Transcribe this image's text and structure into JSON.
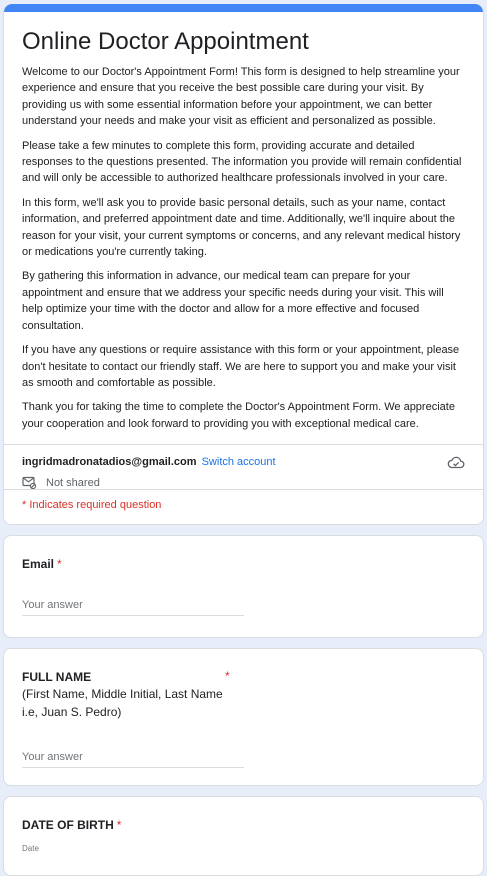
{
  "form": {
    "title": "Online Doctor Appointment",
    "description": [
      "Welcome to our Doctor's Appointment Form! This form is designed to help streamline your experience and ensure that you receive the best possible care during your visit. By providing us with some essential information before your appointment, we can better understand your needs and make your visit as efficient and personalized as possible.",
      "Please take a few minutes to complete this form, providing accurate and detailed responses to the questions presented. The information you provide will remain confidential and will only be accessible to authorized healthcare professionals involved in your care.",
      "In this form, we'll ask you to provide basic personal details, such as your name, contact information, and preferred appointment date and time. Additionally, we'll inquire about the reason for your visit, your current symptoms or concerns, and any relevant medical history or medications you're currently taking.",
      "By gathering this information in advance, our medical team can prepare for your appointment and ensure that we address your specific needs during your visit. This will help optimize your time with the doctor and allow for a more effective and focused consultation.",
      "If you have any questions or require assistance with this form or your appointment, please don't hesitate to contact our friendly staff. We are here to support you and make your visit as smooth and comfortable as possible.",
      "Thank you for taking the time to complete the Doctor's Appointment Form. We appreciate your cooperation and look forward to providing you with exceptional medical care."
    ]
  },
  "account": {
    "email": "ingridmadronatadios@gmail.com",
    "switch_label": "Switch account",
    "shared_label": "Not shared"
  },
  "required_note": "* Indicates required question",
  "questions": {
    "email": {
      "label": "Email",
      "required_mark": "*",
      "placeholder": "Your answer"
    },
    "full_name": {
      "label": "FULL NAME",
      "required_mark": "*",
      "sub": "(First Name, Middle Initial, Last Name i.e, Juan S. Pedro)",
      "placeholder": "Your answer"
    },
    "dob": {
      "label": "DATE OF BIRTH",
      "required_mark": "*",
      "field_label": "Date"
    }
  },
  "colors": {
    "accent": "#4285f4",
    "background": "#e8eef9",
    "required": "#d93025",
    "link": "#1a73e8"
  },
  "icons": {
    "cloud": "cloud-done-icon",
    "mail": "mail-not-shared-icon"
  }
}
